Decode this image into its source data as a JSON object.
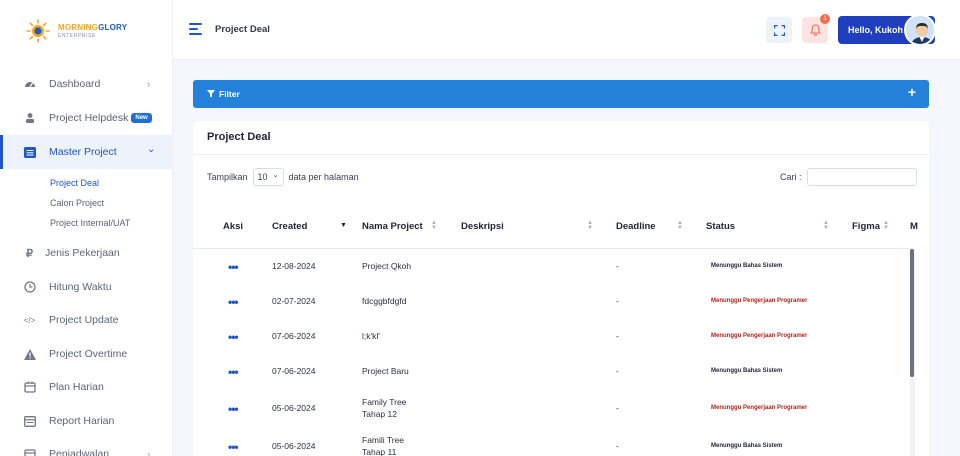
{
  "brand": {
    "line1_a": "MORNING",
    "line1_b": "GLORY",
    "line2": "ENTERPRISE"
  },
  "sidebar": {
    "items": [
      {
        "label": "Dashboard",
        "icon": "dashboard-icon",
        "has_chevron": true
      },
      {
        "label": "Project Helpdesk",
        "icon": "helpdesk-icon",
        "badge": "New"
      },
      {
        "label": "Master Project",
        "icon": "list-icon",
        "has_chevron": true,
        "active": true
      },
      {
        "label": "Jenis Pekerjaan",
        "icon": "rupiah-icon"
      },
      {
        "label": "Hitung Waktu",
        "icon": "clock-icon"
      },
      {
        "label": "Project Update",
        "icon": "code-icon"
      },
      {
        "label": "Project Overtime",
        "icon": "warning-icon"
      },
      {
        "label": "Plan Harian",
        "icon": "calendar-icon"
      },
      {
        "label": "Report Harian",
        "icon": "report-icon"
      },
      {
        "label": "Penjadwalan",
        "icon": "calendar-icon",
        "has_chevron": true
      }
    ],
    "sub_items": [
      {
        "label": "Project Deal",
        "active": true
      },
      {
        "label": "Calon Project"
      },
      {
        "label": "Project Internal/UAT"
      }
    ],
    "chevron": "›",
    "chevron_down": "⌄"
  },
  "header": {
    "title": "Project Deal",
    "notification_count": "1",
    "user_greeting": "Hello, Kukoh"
  },
  "filter": {
    "label": "Filter",
    "add_symbol": "+"
  },
  "card": {
    "title": "Project Deal",
    "show_prefix": "Tampilkan",
    "page_size": "10",
    "show_suffix": "data per halaman",
    "search_label": "Cari :",
    "search_value": ""
  },
  "table": {
    "columns": [
      "Aksi",
      "Created",
      "Nama Project",
      "Deskripsi",
      "Deadline",
      "Status",
      "Figma",
      "M"
    ],
    "action_symbol": "•••",
    "rows": [
      {
        "created": "12-08-2024",
        "name_lines": [
          "Project Qkoh"
        ],
        "deadline": "-",
        "status": "Menunggu Bahas Sistem",
        "status_color": "#1e2433"
      },
      {
        "created": "02-07-2024",
        "name_lines": [
          "fdcggbfdgfd"
        ],
        "deadline": "-",
        "status": "Menunggu Pengerjaan Programer",
        "status_color": "#b42318"
      },
      {
        "created": "07-06-2024",
        "name_lines": [
          "l;k'kl'"
        ],
        "deadline": "-",
        "status": "Menunggu Pengerjaan Programer",
        "status_color": "#b42318"
      },
      {
        "created": "07-06-2024",
        "name_lines": [
          "Project Baru"
        ],
        "deadline": "-",
        "status": "Menunggu Bahas Sistem",
        "status_color": "#1e2433"
      },
      {
        "created": "05-06-2024",
        "name_lines": [
          "Family Tree",
          "Tahap 12"
        ],
        "deadline": "-",
        "status": "Menunggu Pengerjaan Programer",
        "status_color": "#b42318"
      },
      {
        "created": "05-06-2024",
        "name_lines": [
          "Famili Tree",
          "Tahap 11"
        ],
        "deadline": "-",
        "status": "Menunggu Bahas Sistem",
        "status_color": "#1e2433"
      }
    ]
  },
  "colors": {
    "primary": "#1f57c4",
    "filter_bar": "#2381d9",
    "user_button": "#1f3fbf",
    "danger_status": "#b42318"
  }
}
